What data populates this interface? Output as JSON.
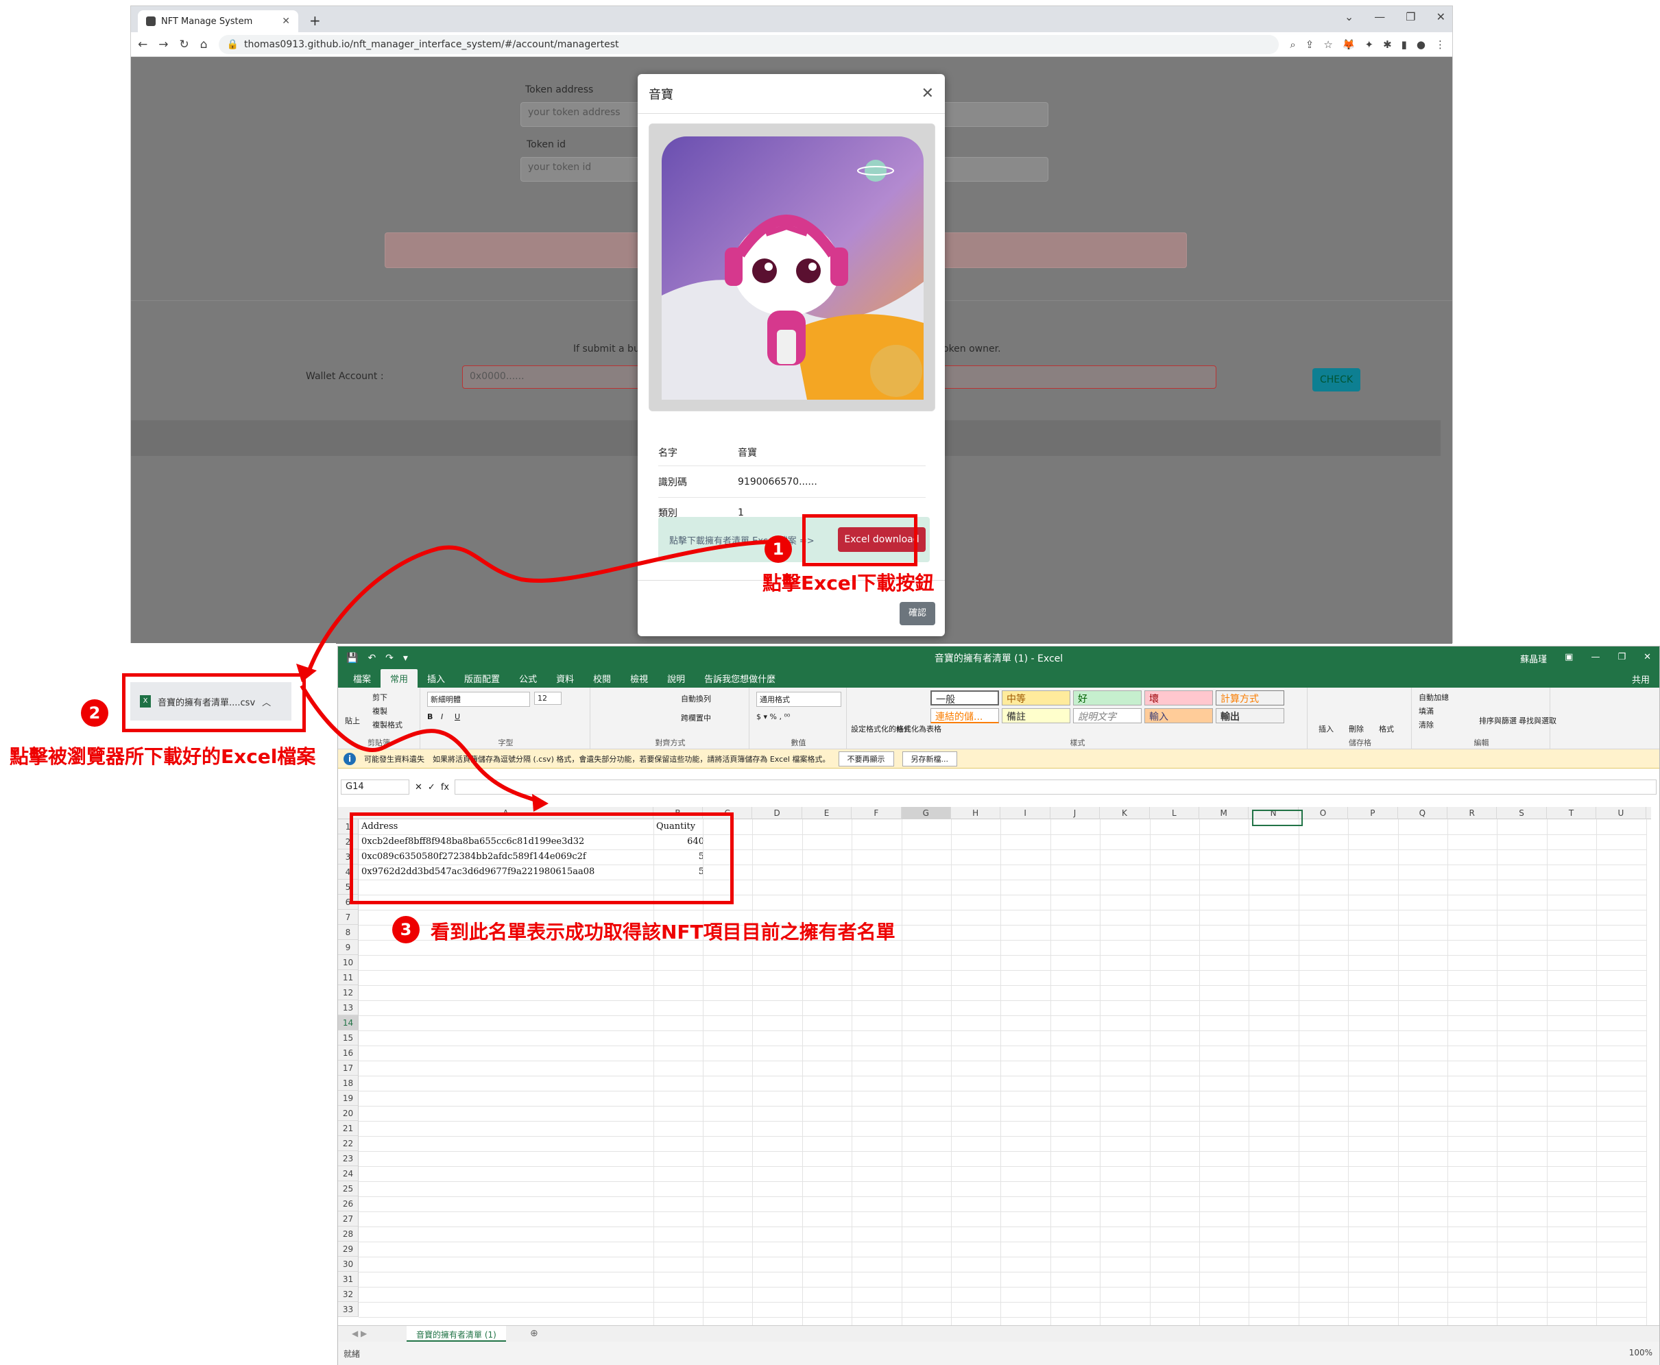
{
  "browser": {
    "tab_title": "NFT Manage System",
    "url": "thomas0913.github.io/nft_manager_interface_system/#/account/managertest",
    "page": {
      "token_address_label": "Token address",
      "token_address_placeholder": "your token address",
      "token_id_label": "Token id",
      "token_id_placeholder": "your token id",
      "hint_left": "If submit a bu",
      "hint_right": "oken owner.",
      "wallet_label": "Wallet Account :",
      "wallet_placeholder": "0x0000......",
      "check_button": "CHECK"
    },
    "download_item": "音寶的擁有者清單....csv"
  },
  "modal": {
    "title": "音寶",
    "rows": [
      {
        "key": "名字",
        "value": "音寶"
      },
      {
        "key": "識別碼",
        "value": "9190066570......"
      },
      {
        "key": "類別",
        "value": "1"
      }
    ],
    "download_hint": "點擊下載擁有者清單 Excel 檔案 =>",
    "excel_button": "Excel download",
    "confirm_button": "確認"
  },
  "excel": {
    "title": "音寶的擁有者清單 (1)  -  Excel",
    "user": "蘇晶瑾",
    "share": "共用",
    "tabs": [
      "檔案",
      "常用",
      "插入",
      "版面配置",
      "公式",
      "資料",
      "校閱",
      "檢視",
      "說明",
      "告訴我您想做什麼"
    ],
    "active_tab": "常用",
    "ribbon": {
      "clipboard": {
        "paste": "貼上",
        "cut": "剪下",
        "copy": "複製",
        "format_painter": "複製格式",
        "label": "剪貼簿"
      },
      "font": {
        "name": "新細明體",
        "size": "12",
        "label": "字型"
      },
      "alignment": {
        "wrap": "自動換列",
        "merge": "跨欄置中",
        "label": "對齊方式"
      },
      "number": {
        "format": "通用格式",
        "label": "數值"
      },
      "styles": {
        "cond_format": "設定格式化的條件",
        "as_table": "格式化為表格",
        "cells": [
          "一般",
          "中等",
          "好",
          "壞",
          "計算方式",
          "連結的儲...",
          "備註",
          "說明文字",
          "輸入",
          "輸出"
        ],
        "label": "樣式"
      },
      "cells": {
        "insert": "插入",
        "delete": "刪除",
        "format": "格式",
        "label": "儲存格"
      },
      "editing": {
        "autosum": "自動加總",
        "fill": "填滿",
        "clear": "清除",
        "sort": "排序與篩選",
        "find": "尋找與選取",
        "label": "編輯"
      }
    },
    "message": {
      "title": "可能發生資料遺失",
      "text": "如果將活頁簿儲存為逗號分隔 (.csv) 格式，會遺失部分功能，若要保留這些功能，請將活頁簿儲存為 Excel 檔案格式。",
      "dont_show": "不要再顯示",
      "save_as": "另存新檔..."
    },
    "name_box": "G14",
    "columns": [
      "A",
      "B",
      "C",
      "D",
      "E",
      "F",
      "G",
      "H",
      "I",
      "J",
      "K",
      "L",
      "M",
      "N",
      "O",
      "P",
      "Q",
      "R",
      "S",
      "T",
      "U"
    ],
    "rows": [
      "1",
      "2",
      "3",
      "4",
      "5",
      "6",
      "7",
      "8",
      "9",
      "10",
      "11",
      "12",
      "13",
      "14",
      "15",
      "16",
      "17",
      "18",
      "19",
      "20",
      "21",
      "22",
      "23",
      "24",
      "25",
      "26",
      "27",
      "28",
      "29",
      "30",
      "31",
      "32",
      "33"
    ],
    "table": {
      "headers": [
        "Address",
        "Quantity"
      ],
      "data": [
        [
          "0xcb2deef8bff8f948ba8ba655cc6c81d199ee3d32",
          "640"
        ],
        [
          "0xc089c6350580f272384bb2afdc589f144e069c2f",
          "5"
        ],
        [
          "0x9762d2dd3bd547ac3d6d9677f9a221980615aa08",
          "5"
        ]
      ]
    },
    "sheet_tab": "音寶的擁有者清單 (1)",
    "status": "就緒",
    "zoom": "100%"
  },
  "annotations": {
    "step1_num": "1",
    "step1_text": "點擊Excel下載按鈕",
    "step2_num": "2",
    "step2_text": "點擊被瀏覽器所下載好的Excel檔案",
    "step3_num": "3",
    "step3_text": "看到此名單表示成功取得該NFT項目目前之擁有者名單"
  },
  "colors": {
    "annotation": "#e00000",
    "excel_green": "#217346",
    "excel_button": "#c0283a"
  }
}
